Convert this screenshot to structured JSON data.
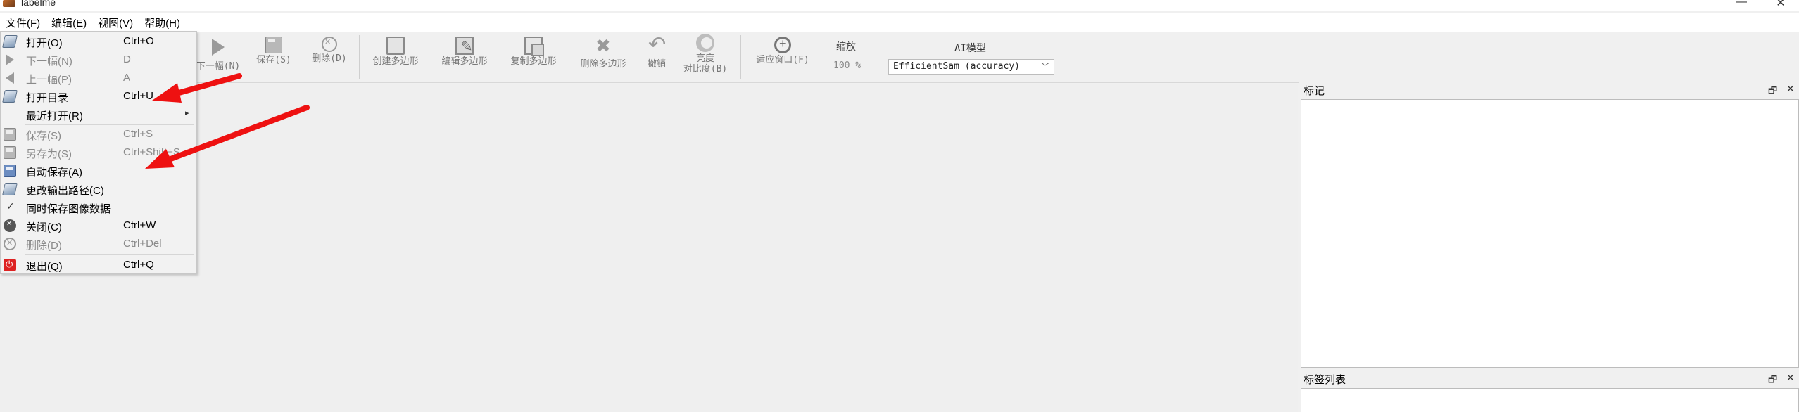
{
  "window": {
    "title": "labelme",
    "minimize": "—",
    "maximize": "☐",
    "close": "✕"
  },
  "menubar": [
    {
      "label": "文件(F)"
    },
    {
      "label": "编辑(E)"
    },
    {
      "label": "视图(V)"
    },
    {
      "label": "帮助(H)"
    }
  ],
  "toolbar": {
    "next": "下一幅(N)",
    "save": "保存(S)",
    "delete": "删除(D)",
    "create_polygon": "创建多边形",
    "edit_polygon": "编辑多边形",
    "copy_polygon": "复制多边形",
    "delete_polygon": "删除多边形",
    "undo": "撤销",
    "brightness_line1": "亮度",
    "brightness_line2": "对比度(B)",
    "fit_window": "适应窗口(F)",
    "zoom_label": "缩放",
    "zoom_value": "100 %",
    "ai_model_label": "AI模型",
    "ai_model_value": "EfficientSam (accuracy)"
  },
  "file_menu": {
    "items": [
      {
        "label": "打开(O)",
        "shortcut": "Ctrl+O",
        "icon": "folder-icon",
        "enabled": true
      },
      {
        "label": "下一幅(N)",
        "shortcut": "D",
        "icon": "arrow-right-icon",
        "enabled": false
      },
      {
        "label": "上一幅(P)",
        "shortcut": "A",
        "icon": "arrow-left-icon",
        "enabled": false
      },
      {
        "label": "打开目录",
        "shortcut": "Ctrl+U",
        "icon": "folder-icon",
        "enabled": true
      },
      {
        "label": "最近打开(R)",
        "shortcut": "",
        "icon": "",
        "enabled": true,
        "submenu": "▸"
      },
      {
        "label": "保存(S)",
        "shortcut": "Ctrl+S",
        "icon": "save-icon",
        "enabled": false
      },
      {
        "label": "另存为(S)",
        "shortcut": "Ctrl+Shift+S",
        "icon": "save-as-icon",
        "enabled": false
      },
      {
        "label": "自动保存(A)",
        "shortcut": "",
        "icon": "save-blue-icon",
        "enabled": true
      },
      {
        "label": "更改输出路径(C)",
        "shortcut": "",
        "icon": "folder-icon",
        "enabled": true
      },
      {
        "label": "同时保存图像数据",
        "shortcut": "",
        "icon": "check-icon",
        "enabled": true
      },
      {
        "label": "关闭(C)",
        "shortcut": "Ctrl+W",
        "icon": "close-icon",
        "enabled": true
      },
      {
        "label": "删除(D)",
        "shortcut": "Ctrl+Del",
        "icon": "delete-icon",
        "enabled": false
      },
      {
        "label": "退出(Q)",
        "shortcut": "Ctrl+Q",
        "icon": "quit-icon",
        "enabled": true
      }
    ]
  },
  "dock": {
    "labels_title": "标记",
    "label_list_title": "标签列表",
    "float_glyph": "🗗",
    "close_glyph": "✕"
  },
  "colors": {
    "arrow": "#ee1111",
    "menu_bg": "#f2f2f2",
    "toolbar_bg": "#f0f0f0"
  }
}
